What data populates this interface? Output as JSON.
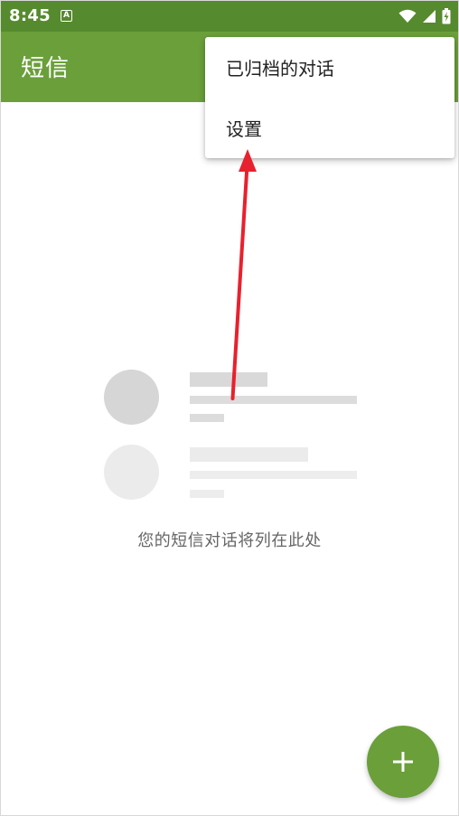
{
  "status_bar": {
    "time": "8:45",
    "notification_badge": "A",
    "icons": [
      "wifi-icon",
      "cell-signal-icon",
      "battery-charging-icon"
    ],
    "background": "#568a2e"
  },
  "app_bar": {
    "title": "短信",
    "background": "#6a9f3a"
  },
  "overflow_menu": {
    "items": [
      {
        "label": "已归档的对话"
      },
      {
        "label": "设置"
      }
    ]
  },
  "empty_state": {
    "message": "您的短信对话将列在此处"
  },
  "fab": {
    "icon": "plus-icon",
    "color": "#6a9f3a"
  },
  "annotation": {
    "color": "#e8212e",
    "points_to": "设置"
  }
}
